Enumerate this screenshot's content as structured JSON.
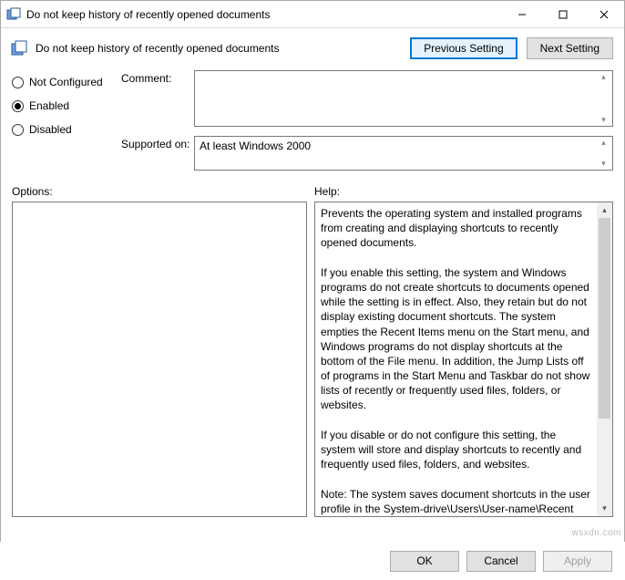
{
  "window": {
    "title": "Do not keep history of recently opened documents"
  },
  "header": {
    "policy_name": "Do not keep history of recently opened documents",
    "prev_btn": "Previous Setting",
    "next_btn": "Next Setting"
  },
  "radios": {
    "not_configured": "Not Configured",
    "enabled": "Enabled",
    "disabled": "Disabled",
    "selected": "enabled"
  },
  "fields": {
    "comment_label": "Comment:",
    "comment_value": "",
    "supported_label": "Supported on:",
    "supported_value": "At least Windows 2000"
  },
  "labels": {
    "options": "Options:",
    "help": "Help:"
  },
  "help_text": "Prevents the operating system and installed programs from creating and displaying shortcuts to recently opened documents.\n\nIf you enable this setting, the system and Windows programs do not create shortcuts to documents opened while the setting is in effect. Also, they retain but do not display existing document shortcuts. The system empties the Recent Items menu on the Start menu, and Windows programs do not display shortcuts at the bottom of the File menu. In addition, the Jump Lists off of programs in the Start Menu and Taskbar do not show lists of recently or frequently used files, folders, or websites.\n\nIf you disable or do not configure this setting, the system will store and display shortcuts to recently and frequently used files, folders, and websites.\n\nNote: The system saves document shortcuts in the user profile in the System-drive\\Users\\User-name\\Recent folder.\n\nAlso, see the \"Remove Recent Items menu from Start Menu\" and \"Clear history of recently opened documents on exit\" policies in",
  "footer": {
    "ok": "OK",
    "cancel": "Cancel",
    "apply": "Apply"
  },
  "watermark": "wsxdn.com"
}
